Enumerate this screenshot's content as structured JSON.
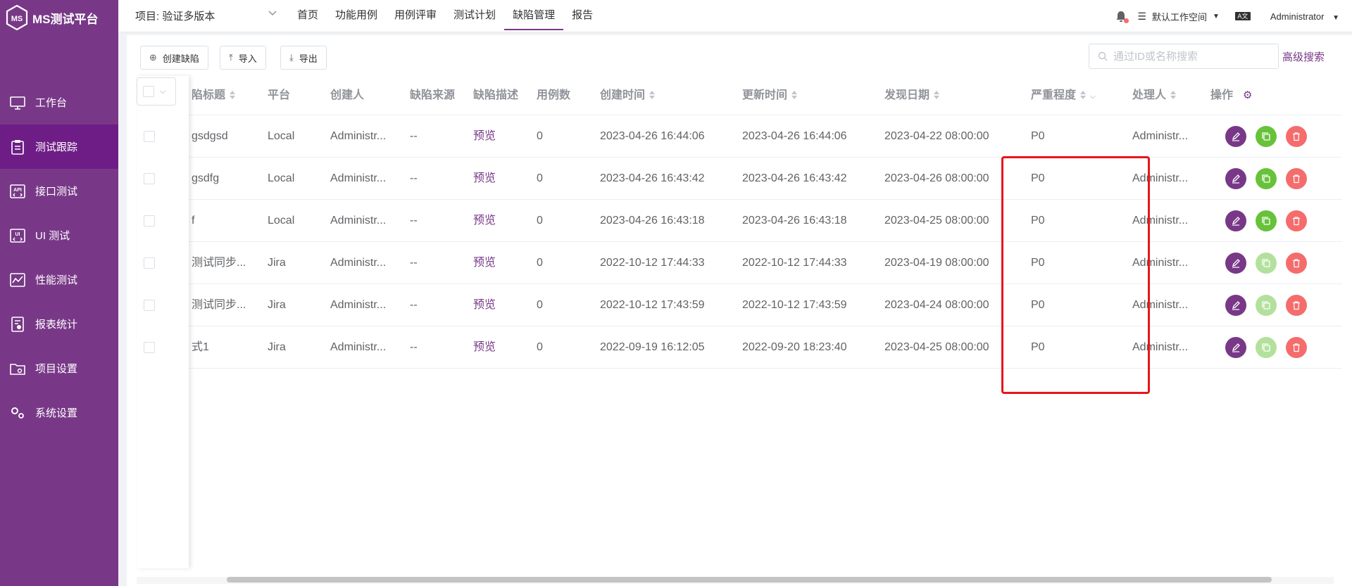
{
  "app": {
    "logo_text": "MS测试平台",
    "accent": "#783887"
  },
  "sidebar": {
    "items": [
      {
        "label": "工作台",
        "icon": "monitor-icon"
      },
      {
        "label": "测试跟踪",
        "icon": "clipboard-icon",
        "active": true
      },
      {
        "label": "接口测试",
        "icon": "api-icon"
      },
      {
        "label": "UI 测试",
        "icon": "ui-icon"
      },
      {
        "label": "性能测试",
        "icon": "performance-chart-icon"
      },
      {
        "label": "报表统计",
        "icon": "report-icon"
      },
      {
        "label": "项目设置",
        "icon": "folder-settings-icon"
      },
      {
        "label": "系统设置",
        "icon": "gears-icon"
      }
    ]
  },
  "header": {
    "project": "项目: 验证多版本",
    "menu": [
      "首页",
      "功能用例",
      "用例评审",
      "测试计划",
      "缺陷管理",
      "报告"
    ],
    "active_menu": "缺陷管理",
    "workspace": "默认工作空间",
    "lang_icon": "language-icon",
    "user": "Administrator"
  },
  "toolbar": {
    "create": "创建缺陷",
    "import": "导入",
    "export": "导出",
    "search_placeholder": "通过ID或名称搜索",
    "advanced": "高级搜索"
  },
  "table": {
    "headers": {
      "title": "陷标题",
      "platform": "平台",
      "creator": "创建人",
      "source": "缺陷来源",
      "desc": "缺陷描述",
      "case_count": "用例数",
      "created": "创建时间",
      "updated": "更新时间",
      "found": "发现日期",
      "severity": "严重程度",
      "handler": "处理人",
      "ops": "操作"
    },
    "rows": [
      {
        "title": "gsdgsd",
        "platform": "Local",
        "creator": "Administr...",
        "source": "--",
        "desc": "预览",
        "case_count": "0",
        "created": "2023-04-26 16:44:06",
        "updated": "2023-04-26 16:44:06",
        "found": "2023-04-22 08:00:00",
        "severity": "P0",
        "handler": "Administr...",
        "copy_enabled": true
      },
      {
        "title": "gsdfg",
        "platform": "Local",
        "creator": "Administr...",
        "source": "--",
        "desc": "预览",
        "case_count": "0",
        "created": "2023-04-26 16:43:42",
        "updated": "2023-04-26 16:43:42",
        "found": "2023-04-26 08:00:00",
        "severity": "P0",
        "handler": "Administr...",
        "copy_enabled": true
      },
      {
        "title": "f",
        "platform": "Local",
        "creator": "Administr...",
        "source": "--",
        "desc": "预览",
        "case_count": "0",
        "created": "2023-04-26 16:43:18",
        "updated": "2023-04-26 16:43:18",
        "found": "2023-04-25 08:00:00",
        "severity": "P0",
        "handler": "Administr...",
        "copy_enabled": true
      },
      {
        "title": "测试同步...",
        "platform": "Jira",
        "creator": "Administr...",
        "source": "--",
        "desc": "预览",
        "case_count": "0",
        "created": "2022-10-12 17:44:33",
        "updated": "2022-10-12 17:44:33",
        "found": "2023-04-19 08:00:00",
        "severity": "P0",
        "handler": "Administr...",
        "copy_enabled": false
      },
      {
        "title": "测试同步...",
        "platform": "Jira",
        "creator": "Administr...",
        "source": "--",
        "desc": "预览",
        "case_count": "0",
        "created": "2022-10-12 17:43:59",
        "updated": "2022-10-12 17:43:59",
        "found": "2023-04-24 08:00:00",
        "severity": "P0",
        "handler": "Administr...",
        "copy_enabled": false
      },
      {
        "title": "式1",
        "platform": "Jira",
        "creator": "Administr...",
        "source": "--",
        "desc": "预览",
        "case_count": "0",
        "created": "2022-09-19 16:12:05",
        "updated": "2022-09-20 18:23:40",
        "found": "2023-04-25 08:00:00",
        "severity": "P0",
        "handler": "Administr...",
        "copy_enabled": false
      }
    ]
  }
}
